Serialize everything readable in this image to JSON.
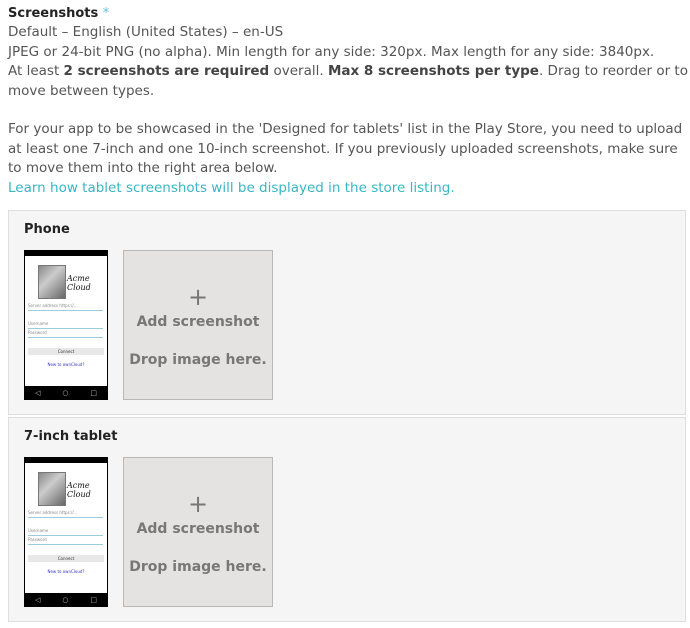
{
  "screenshots": {
    "title": "Screenshots",
    "required_mark": "*",
    "language_line": "Default – English (United States) – en-US",
    "format_line": "JPEG or 24-bit PNG (no alpha). Min length for any side: 320px. Max length for any side: 3840px.",
    "count_prefix": "At least ",
    "count_bold1": "2 screenshots are required",
    "count_mid": " overall. ",
    "count_bold2": "Max 8 screenshots per type",
    "count_suffix": ". Drag to reorder or to move between types.",
    "tablet_note": "For your app to be showcased in the 'Designed for tablets' list in the Play Store, you need to upload at least one 7-inch and one 10-inch screenshot. If you previously uploaded screenshots, make sure to move them into the right area below.",
    "learn_link": "Learn how tablet screenshots will be displayed in the store listing."
  },
  "sections": [
    {
      "title": "Phone",
      "thumb": {
        "brand_line1": "Acme",
        "brand_line2": "Cloud",
        "server_field": "Server address https://...",
        "username_field": "Username",
        "password_field": "Password",
        "connect_button": "Connect",
        "new_link": "New to ownCloud?",
        "nav_back": "◁",
        "nav_home": "○",
        "nav_recent": "□"
      },
      "dropzone": {
        "plus": "+",
        "add": "Add screenshot",
        "drop": "Drop image here."
      }
    },
    {
      "title": "7-inch tablet",
      "thumb": {
        "brand_line1": "Acme",
        "brand_line2": "Cloud",
        "server_field": "Server address https://...",
        "username_field": "Username",
        "password_field": "Password",
        "connect_button": "Connect",
        "new_link": "New to ownCloud?",
        "nav_back": "◁",
        "nav_home": "○",
        "nav_recent": "□"
      },
      "dropzone": {
        "plus": "+",
        "add": "Add screenshot",
        "drop": "Drop image here."
      }
    }
  ],
  "colors": {
    "link": "#3ab5c4",
    "required": "#5bc0de",
    "panel_bg": "#f5f5f5",
    "dropzone_bg": "#e4e3e1"
  }
}
